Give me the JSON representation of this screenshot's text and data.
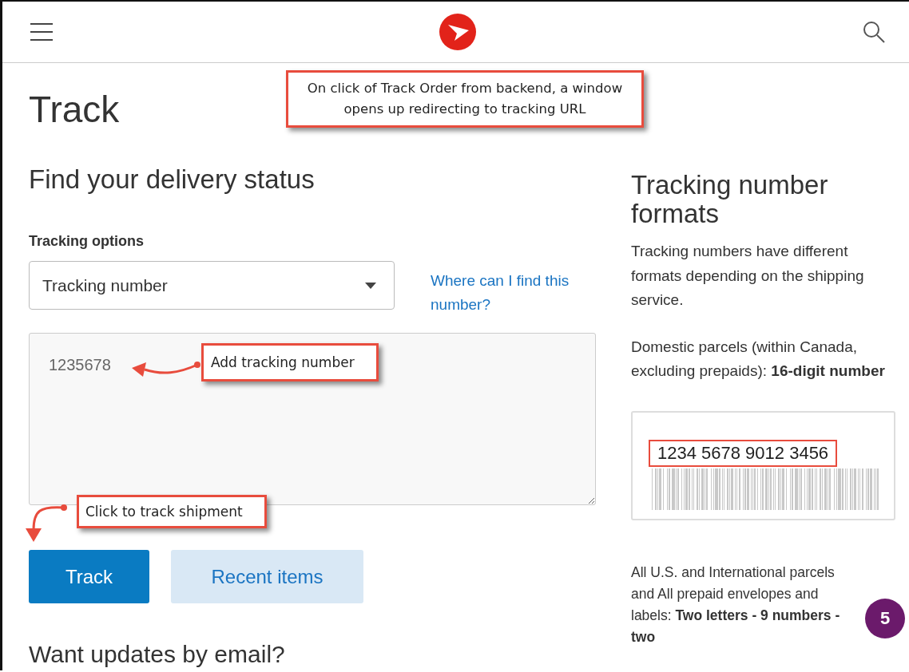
{
  "header": {
    "menu": true,
    "search": true
  },
  "page_title": "Track",
  "form": {
    "heading": "Find your delivery status",
    "options_label": "Tracking options",
    "dropdown": {
      "value": "Tracking number"
    },
    "help_link": "Where can I find this number?",
    "tracking_field": {
      "value": "1235678"
    },
    "buttons": [
      {
        "label": "Track",
        "kind": "primary"
      },
      {
        "label": "Recent items",
        "kind": "secondary"
      }
    ],
    "email_heading": "Want updates by email?"
  },
  "sidebar": {
    "heading": "Tracking number formats",
    "intro": "Tracking numbers have different formats depending on the shipping service.",
    "domestic": "Domestic parcels (within Canada, excluding prepaids): **16-digit number**",
    "example": {
      "number": "1234 5678 9012 3456",
      "highlighted": true
    },
    "international": "All U.S. and International parcels and All prepaid envelopes and labels: **Two letters - 9 numbers - two**"
  },
  "badge": "5",
  "annotations": [
    {
      "kind": "top",
      "text": "On click of Track Order from backend, a window opens up redirecting to tracking URL"
    },
    {
      "kind": "field",
      "text": "Add tracking number"
    },
    {
      "kind": "button",
      "text": "Click to track shipment"
    }
  ]
}
